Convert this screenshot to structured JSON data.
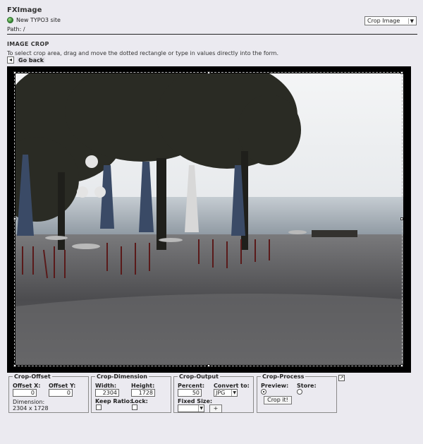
{
  "header": {
    "app_title": "FXImage",
    "site_name": "New TYPO3 site",
    "path": "Path: /",
    "mode_select_value": "Crop Image"
  },
  "section": {
    "title": "IMAGE CROP",
    "instructions": "To select crop area, drag and move the dotted rectangle or type in values directly into the form.",
    "go_back_label": "Go back"
  },
  "crop_offset": {
    "legend": "Crop-Offset",
    "offset_x_label": "Offset X:",
    "offset_y_label": "Offset Y:",
    "offset_x_value": "0",
    "offset_y_value": "0",
    "dimension_label": "Dimension:",
    "dimension_value": "2304 x 1728"
  },
  "crop_dimension": {
    "legend": "Crop-Dimension",
    "width_label": "Width:",
    "height_label": "Height:",
    "width_value": "2304",
    "height_value": "1728",
    "keep_ratio_label": "Keep Ratio:",
    "lock_label": "Lock:"
  },
  "crop_output": {
    "legend": "Crop-Output",
    "percent_label": "Percent:",
    "percent_value": "50",
    "convert_label": "Convert to:",
    "convert_value": "JPG",
    "fixed_size_label": "Fixed Size:",
    "fixed_size_value": "",
    "add_button": "+"
  },
  "crop_process": {
    "legend": "Crop-Process",
    "preview_label": "Preview:",
    "store_label": "Store:",
    "crop_button": "Crop it!"
  },
  "icons": {
    "site": "globe-icon",
    "back": "back-arrow-icon",
    "expand": "expand-icon"
  }
}
